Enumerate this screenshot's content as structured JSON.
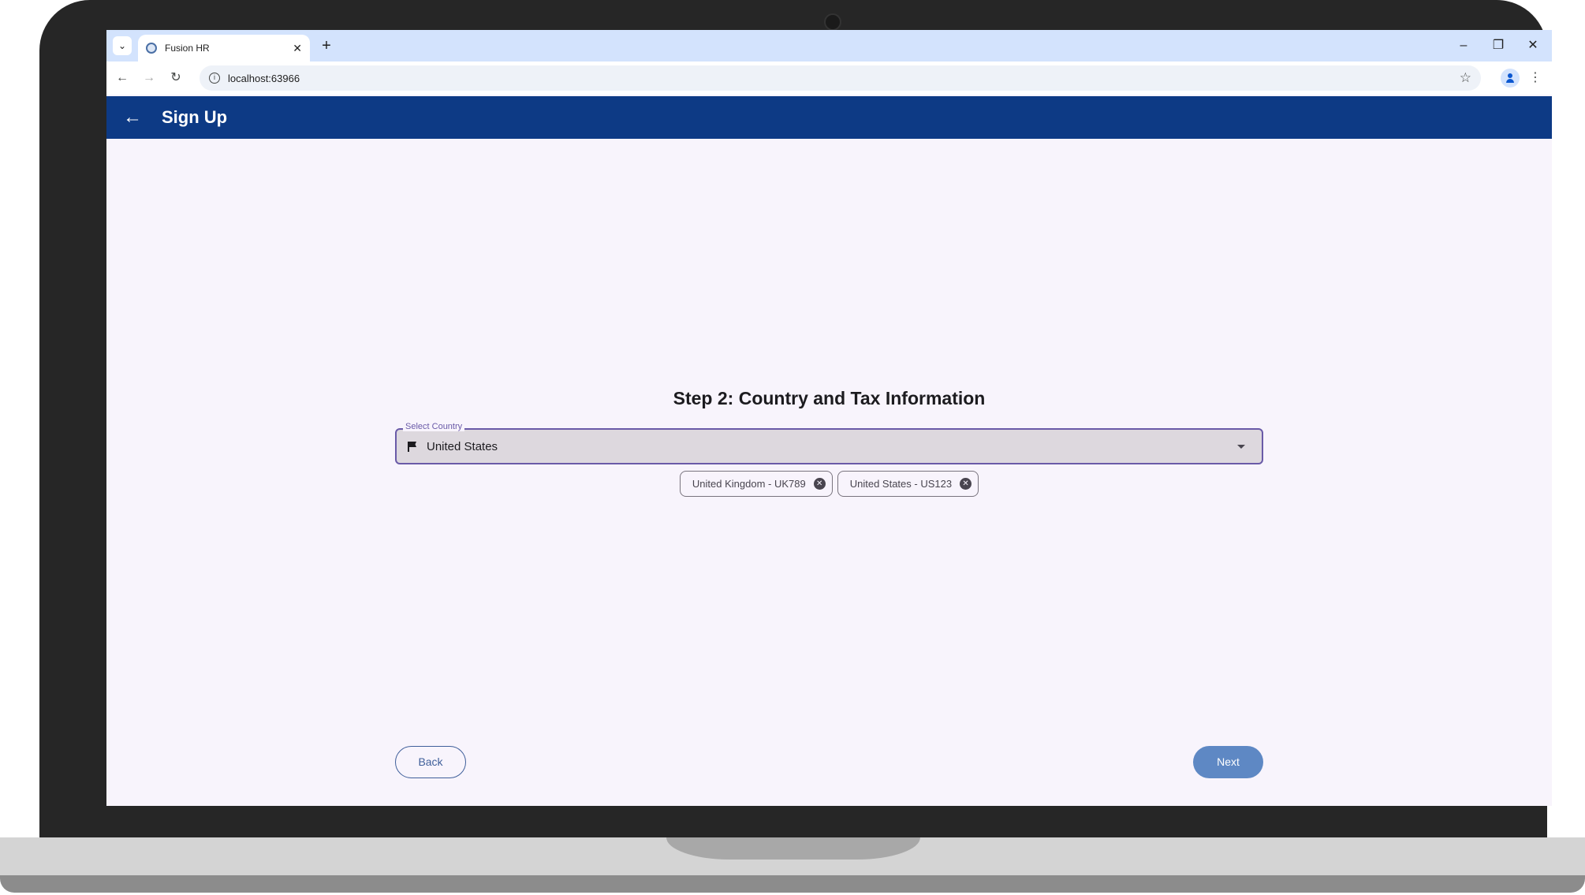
{
  "browser": {
    "tab_title": "Fusion HR",
    "tab_close": "✕",
    "new_tab": "+",
    "tab_menu": "⌄",
    "url": "localhost:63966",
    "window": {
      "minimize": "–",
      "restore": "❐",
      "close": "✕"
    },
    "nav": {
      "back": "←",
      "forward": "→",
      "reload": "↻"
    },
    "site_info": "i",
    "bookmark": "☆",
    "menu": "⋮"
  },
  "appbar": {
    "back_glyph": "←",
    "title": "Sign Up"
  },
  "step": {
    "title": "Step 2: Country and Tax Information"
  },
  "country_select": {
    "label": "Select Country",
    "value": "United States",
    "icon": "flag-icon"
  },
  "chips": [
    {
      "label": "United Kingdom - UK789",
      "remove": "✕"
    },
    {
      "label": "United States - US123",
      "remove": "✕"
    }
  ],
  "actions": {
    "back_label": "Back",
    "next_label": "Next"
  },
  "colors": {
    "appbar": "#0d3a85",
    "page_background": "#f8f4fc",
    "field_border": "#6a5aa8",
    "next_button": "#5e88c4"
  }
}
